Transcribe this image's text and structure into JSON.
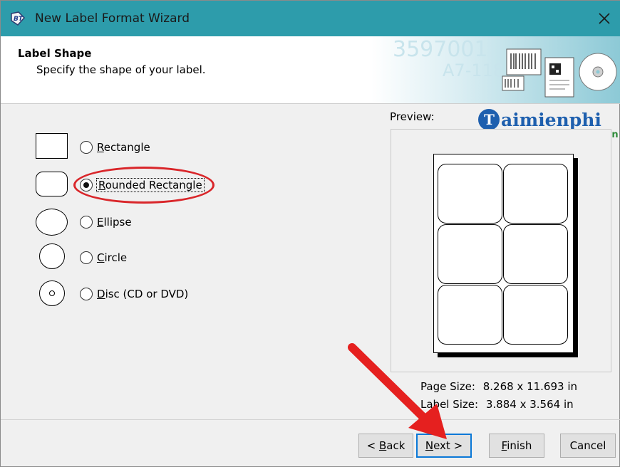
{
  "window": {
    "title": "New Label Format Wizard",
    "close_glyph": "✕"
  },
  "header": {
    "title": "Label Shape",
    "subtitle": "Specify the shape of your label.",
    "banner_text_1": "3597001",
    "banner_text_2": "A7-118"
  },
  "shapes": [
    {
      "key": "R",
      "rest": "ectangle",
      "selected": false
    },
    {
      "key": "R",
      "rest": "ounded Rectangle",
      "selected": true
    },
    {
      "key": "E",
      "rest": "llipse",
      "selected": false
    },
    {
      "key": "C",
      "rest": "ircle",
      "selected": false
    },
    {
      "key": "D",
      "rest": "isc (CD or DVD)",
      "selected": false
    }
  ],
  "preview": {
    "label": "Preview:",
    "columns": 2,
    "rows": 3
  },
  "info": {
    "page_size_label": "Page Size:",
    "page_size_value": "8.268 x 11.693 in",
    "label_size_label": "Label Size:",
    "label_size_value": "3.884 x 3.564 in"
  },
  "watermark": {
    "text": "aimienphi",
    "suffix": ".vn"
  },
  "buttons": {
    "back_prefix": "< ",
    "back_key": "B",
    "back_rest": "ack",
    "next_key": "N",
    "next_rest": "ext >",
    "finish_key": "F",
    "finish_rest": "inish",
    "cancel": "Cancel"
  },
  "colors": {
    "titlebar": "#2d9cab",
    "highlight": "#d9262a",
    "default_button_border": "#0a78d7"
  }
}
